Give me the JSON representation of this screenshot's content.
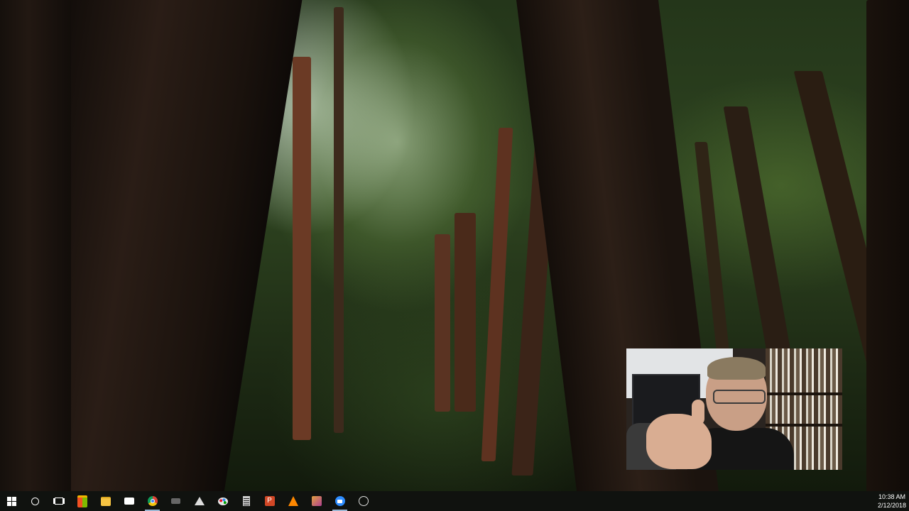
{
  "desktop": {
    "wallpaper": "redwood-forest"
  },
  "webcam_overlay": {
    "content": "presenter-webcam"
  },
  "taskbar": {
    "buttons": [
      {
        "name": "start-button",
        "icon": "windows-logo-icon"
      },
      {
        "name": "search-button",
        "icon": "search-circle-icon"
      },
      {
        "name": "task-view-button",
        "icon": "task-view-icon"
      },
      {
        "name": "taskbar-store",
        "icon": "store-bag-icon",
        "color": "#f2b400"
      },
      {
        "name": "taskbar-file-explorer",
        "icon": "folder-icon",
        "color": "#f6c342"
      },
      {
        "name": "taskbar-mail",
        "icon": "envelope-icon",
        "color": "#ffffff"
      },
      {
        "name": "taskbar-chrome",
        "icon": "chrome-icon",
        "color": "#db4437"
      },
      {
        "name": "taskbar-app-generic",
        "icon": "capture-icon",
        "color": "#555555"
      },
      {
        "name": "taskbar-inkscape",
        "icon": "inkscape-icon",
        "color": "#333333"
      },
      {
        "name": "taskbar-paint",
        "icon": "palette-icon",
        "color": "#2d89ef"
      },
      {
        "name": "taskbar-calculator",
        "icon": "calculator-icon",
        "color": "#cccccc"
      },
      {
        "name": "taskbar-powerpoint",
        "icon": "powerpoint-icon",
        "color": "#d24726"
      },
      {
        "name": "taskbar-vlc",
        "icon": "vlc-cone-icon",
        "color": "#ff8800"
      },
      {
        "name": "taskbar-media",
        "icon": "media-app-icon",
        "color": "#b04090"
      },
      {
        "name": "taskbar-zoom",
        "icon": "zoom-camera-icon",
        "color": "#2d8cff"
      },
      {
        "name": "taskbar-obs",
        "icon": "obs-icon",
        "color": "#cccccc"
      }
    ],
    "clock": {
      "time": "10:38 AM",
      "date": "2/12/2018"
    }
  }
}
